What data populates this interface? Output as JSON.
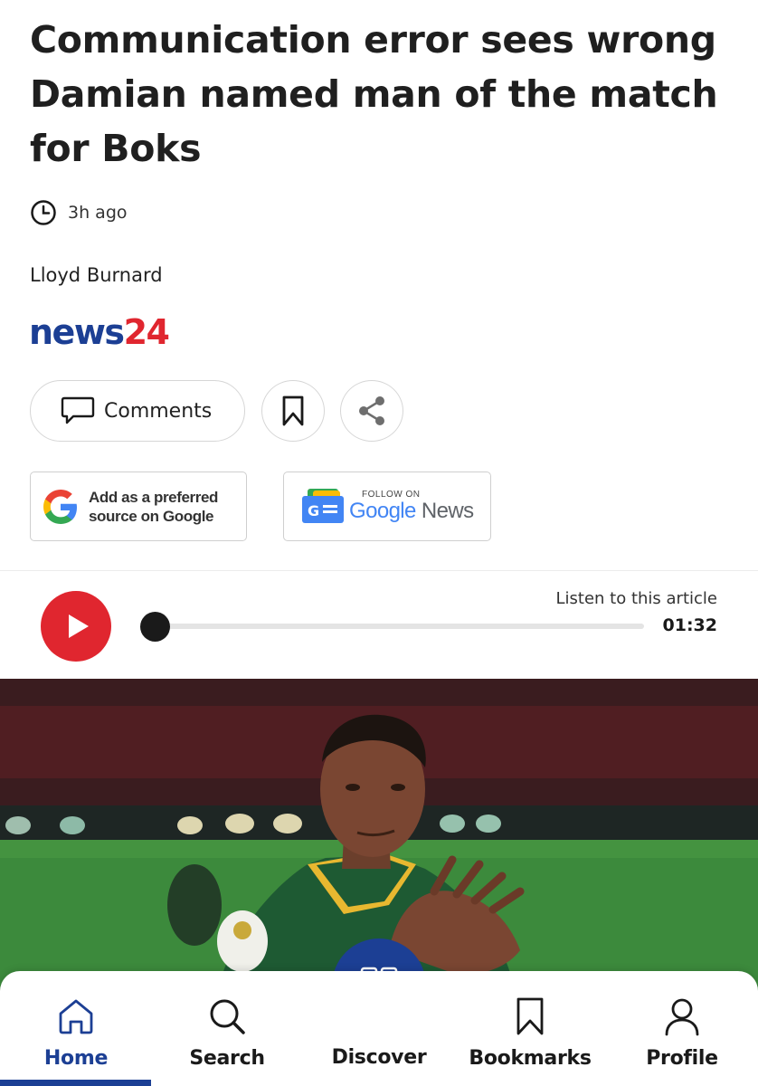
{
  "article": {
    "headline": "Communication error sees wrong Damian named man of the match for Boks",
    "time_ago": "3h ago",
    "author": "Lloyd Burnard",
    "brand": {
      "part1": "news",
      "part2": "24"
    }
  },
  "actions": {
    "comments_label": "Comments"
  },
  "badges": {
    "google_source_line1": "Add as a preferred",
    "google_source_line2": "source on Google",
    "gnews_follow": "FOLLOW ON",
    "gnews_google": "Google",
    "gnews_news": "News"
  },
  "audio": {
    "listen_label": "Listen to this article",
    "duration": "01:32",
    "progress": 0
  },
  "nav": {
    "home": "Home",
    "search": "Search",
    "discover": "Discover",
    "bookmarks": "Bookmarks",
    "profile": "Profile"
  },
  "colors": {
    "brand_blue": "#1c3f94",
    "brand_red": "#e0262f"
  }
}
